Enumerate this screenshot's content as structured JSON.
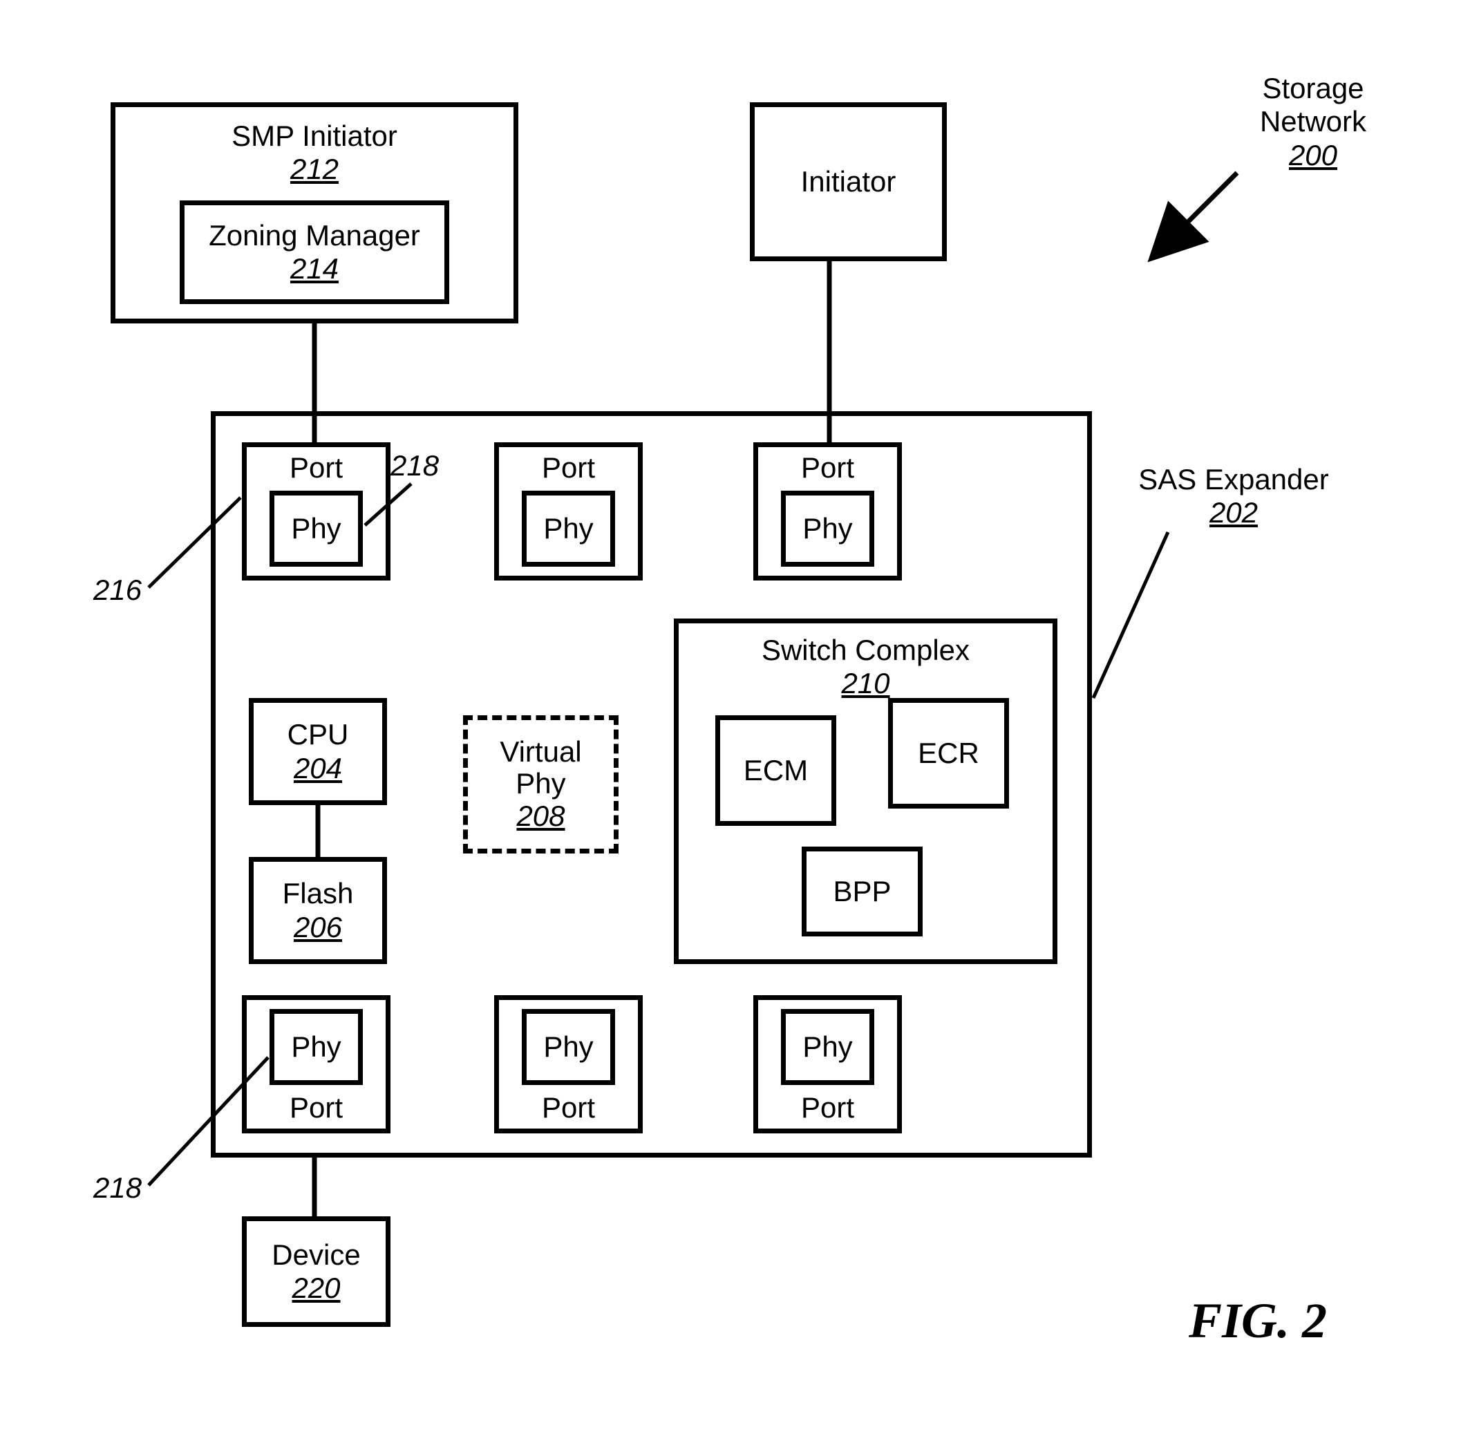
{
  "title": "Storage Network",
  "title_ref": "200",
  "figure": "FIG. 2",
  "smp_initiator": {
    "title": "SMP Initiator",
    "ref": "212"
  },
  "zoning_manager": {
    "title": "Zoning Manager",
    "ref": "214"
  },
  "initiator": "Initiator",
  "sas_expander": {
    "title": "SAS Expander",
    "ref": "202"
  },
  "port": "Port",
  "phy": "Phy",
  "cpu": {
    "title": "CPU",
    "ref": "204"
  },
  "flash": {
    "title": "Flash",
    "ref": "206"
  },
  "virtual_phy": {
    "title": "Virtual Phy",
    "ref": "208"
  },
  "switch_complex": {
    "title": "Switch Complex",
    "ref": "210"
  },
  "ecm": "ECM",
  "ecr": "ECR",
  "bpp": "BPP",
  "device": {
    "title": "Device",
    "ref": "220"
  },
  "ref_216": "216",
  "ref_218a": "218",
  "ref_218b": "218"
}
